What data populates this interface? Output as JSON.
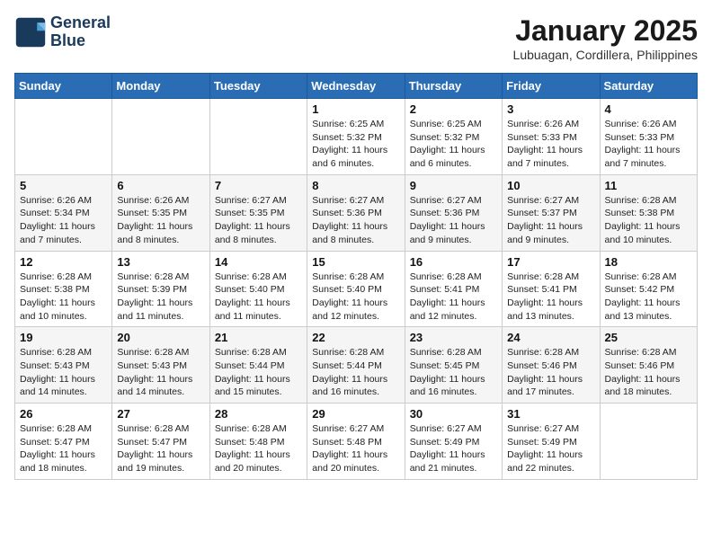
{
  "header": {
    "logo_line1": "General",
    "logo_line2": "Blue",
    "month": "January 2025",
    "location": "Lubuagan, Cordillera, Philippines"
  },
  "weekdays": [
    "Sunday",
    "Monday",
    "Tuesday",
    "Wednesday",
    "Thursday",
    "Friday",
    "Saturday"
  ],
  "weeks": [
    [
      {
        "day": "",
        "info": ""
      },
      {
        "day": "",
        "info": ""
      },
      {
        "day": "",
        "info": ""
      },
      {
        "day": "1",
        "info": "Sunrise: 6:25 AM\nSunset: 5:32 PM\nDaylight: 11 hours and 6 minutes."
      },
      {
        "day": "2",
        "info": "Sunrise: 6:25 AM\nSunset: 5:32 PM\nDaylight: 11 hours and 6 minutes."
      },
      {
        "day": "3",
        "info": "Sunrise: 6:26 AM\nSunset: 5:33 PM\nDaylight: 11 hours and 7 minutes."
      },
      {
        "day": "4",
        "info": "Sunrise: 6:26 AM\nSunset: 5:33 PM\nDaylight: 11 hours and 7 minutes."
      }
    ],
    [
      {
        "day": "5",
        "info": "Sunrise: 6:26 AM\nSunset: 5:34 PM\nDaylight: 11 hours and 7 minutes."
      },
      {
        "day": "6",
        "info": "Sunrise: 6:26 AM\nSunset: 5:35 PM\nDaylight: 11 hours and 8 minutes."
      },
      {
        "day": "7",
        "info": "Sunrise: 6:27 AM\nSunset: 5:35 PM\nDaylight: 11 hours and 8 minutes."
      },
      {
        "day": "8",
        "info": "Sunrise: 6:27 AM\nSunset: 5:36 PM\nDaylight: 11 hours and 8 minutes."
      },
      {
        "day": "9",
        "info": "Sunrise: 6:27 AM\nSunset: 5:36 PM\nDaylight: 11 hours and 9 minutes."
      },
      {
        "day": "10",
        "info": "Sunrise: 6:27 AM\nSunset: 5:37 PM\nDaylight: 11 hours and 9 minutes."
      },
      {
        "day": "11",
        "info": "Sunrise: 6:28 AM\nSunset: 5:38 PM\nDaylight: 11 hours and 10 minutes."
      }
    ],
    [
      {
        "day": "12",
        "info": "Sunrise: 6:28 AM\nSunset: 5:38 PM\nDaylight: 11 hours and 10 minutes."
      },
      {
        "day": "13",
        "info": "Sunrise: 6:28 AM\nSunset: 5:39 PM\nDaylight: 11 hours and 11 minutes."
      },
      {
        "day": "14",
        "info": "Sunrise: 6:28 AM\nSunset: 5:40 PM\nDaylight: 11 hours and 11 minutes."
      },
      {
        "day": "15",
        "info": "Sunrise: 6:28 AM\nSunset: 5:40 PM\nDaylight: 11 hours and 12 minutes."
      },
      {
        "day": "16",
        "info": "Sunrise: 6:28 AM\nSunset: 5:41 PM\nDaylight: 11 hours and 12 minutes."
      },
      {
        "day": "17",
        "info": "Sunrise: 6:28 AM\nSunset: 5:41 PM\nDaylight: 11 hours and 13 minutes."
      },
      {
        "day": "18",
        "info": "Sunrise: 6:28 AM\nSunset: 5:42 PM\nDaylight: 11 hours and 13 minutes."
      }
    ],
    [
      {
        "day": "19",
        "info": "Sunrise: 6:28 AM\nSunset: 5:43 PM\nDaylight: 11 hours and 14 minutes."
      },
      {
        "day": "20",
        "info": "Sunrise: 6:28 AM\nSunset: 5:43 PM\nDaylight: 11 hours and 14 minutes."
      },
      {
        "day": "21",
        "info": "Sunrise: 6:28 AM\nSunset: 5:44 PM\nDaylight: 11 hours and 15 minutes."
      },
      {
        "day": "22",
        "info": "Sunrise: 6:28 AM\nSunset: 5:44 PM\nDaylight: 11 hours and 16 minutes."
      },
      {
        "day": "23",
        "info": "Sunrise: 6:28 AM\nSunset: 5:45 PM\nDaylight: 11 hours and 16 minutes."
      },
      {
        "day": "24",
        "info": "Sunrise: 6:28 AM\nSunset: 5:46 PM\nDaylight: 11 hours and 17 minutes."
      },
      {
        "day": "25",
        "info": "Sunrise: 6:28 AM\nSunset: 5:46 PM\nDaylight: 11 hours and 18 minutes."
      }
    ],
    [
      {
        "day": "26",
        "info": "Sunrise: 6:28 AM\nSunset: 5:47 PM\nDaylight: 11 hours and 18 minutes."
      },
      {
        "day": "27",
        "info": "Sunrise: 6:28 AM\nSunset: 5:47 PM\nDaylight: 11 hours and 19 minutes."
      },
      {
        "day": "28",
        "info": "Sunrise: 6:28 AM\nSunset: 5:48 PM\nDaylight: 11 hours and 20 minutes."
      },
      {
        "day": "29",
        "info": "Sunrise: 6:27 AM\nSunset: 5:48 PM\nDaylight: 11 hours and 20 minutes."
      },
      {
        "day": "30",
        "info": "Sunrise: 6:27 AM\nSunset: 5:49 PM\nDaylight: 11 hours and 21 minutes."
      },
      {
        "day": "31",
        "info": "Sunrise: 6:27 AM\nSunset: 5:49 PM\nDaylight: 11 hours and 22 minutes."
      },
      {
        "day": "",
        "info": ""
      }
    ]
  ]
}
